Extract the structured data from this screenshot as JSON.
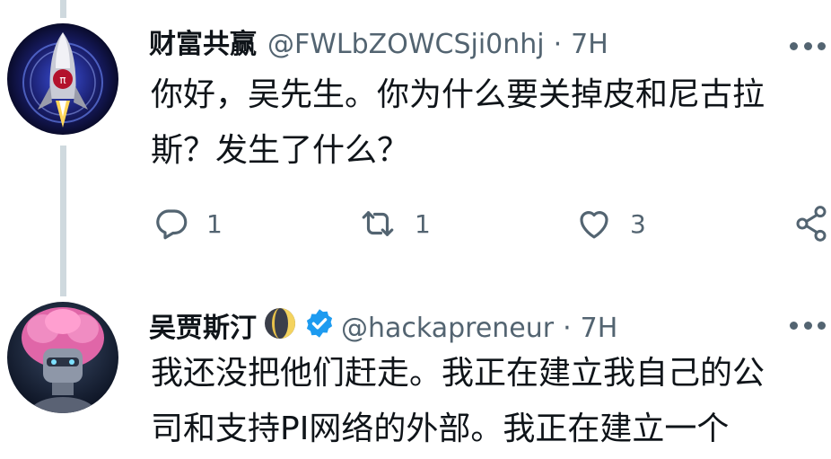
{
  "tweets": [
    {
      "name": "财富共赢",
      "handle": "@FWLbZOWCSji0nhj",
      "separator": "·",
      "time": "7H",
      "lines": [
        "你好，吴先生。你为什么要关掉皮和尼古拉",
        "斯？发生了什么？"
      ],
      "actions": {
        "reply": "1",
        "retweet": "1",
        "like": "3"
      }
    },
    {
      "name": "吴贾斯汀",
      "handle": "@hackapreneur",
      "separator": "·",
      "time": "7H",
      "lines": [
        "我还没把他们赶走。我正在建立我自己的公",
        "司和支持PI网络的外部。我正在建立一个"
      ]
    }
  ],
  "icons": [
    "reply-icon",
    "retweet-icon",
    "like-icon",
    "share-icon",
    "more-icon",
    "verified-badge-icon",
    "moon-emoji-icon"
  ],
  "colors": {
    "text": "#0f1419",
    "secondary": "#536471",
    "verified": "#1d9bf0",
    "thread_line": "#cfd9de"
  }
}
